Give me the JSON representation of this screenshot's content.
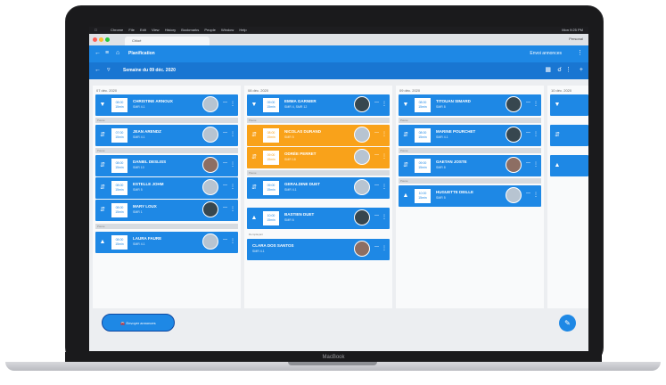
{
  "device": {
    "brand": "MacBook"
  },
  "macos_bar": {
    "app": "Chrome",
    "menu": [
      "File",
      "Edit",
      "View",
      "History",
      "Bookmarks",
      "People",
      "Window",
      "Help"
    ],
    "status": "Mon 9:25 PM"
  },
  "browser": {
    "tab_title": "Chloé",
    "profile": "Personal"
  },
  "appbar": {
    "title": "Planification",
    "right_link": "Envoi annonces"
  },
  "subbar": {
    "week_label": "Semaine du 09 déc. 2020"
  },
  "columns": [
    {
      "date": "07 déc. 2020"
    },
    {
      "date": "08 déc. 2020"
    },
    {
      "date": "09 déc. 2020"
    },
    {
      "date": "10 déc. 2020"
    }
  ],
  "cards": {
    "c1": {
      "time": "08:00",
      "duration": "15min",
      "name": "CHRISTINE ARNOUX",
      "sub": "SMR 4.1"
    },
    "c2": {
      "time": "07:00",
      "duration": "15min",
      "name": "JEAN ARENDZ",
      "sub": "SMR 4.1"
    },
    "c3": {
      "time": "08:00",
      "duration": "15min",
      "name": "DANIEL DESLISS",
      "sub": "SMR 10"
    },
    "c4": {
      "time": "08:00",
      "duration": "15min",
      "name": "ESTELLE JOHM",
      "sub": "SMR 5"
    },
    "c5": {
      "time": "08:00",
      "duration": "15min",
      "name": "MARY LOUX",
      "sub": "SMR 1"
    },
    "c6": {
      "time": "08:00",
      "duration": "15min",
      "name": "LAURA FAURE",
      "sub": "SMR 4.1"
    },
    "c7": {
      "time": "09:00",
      "duration": "15min",
      "name": "EMMA GARNIER",
      "sub": "SMR 4, SMR 12"
    },
    "c8": {
      "time": "08:00",
      "duration": "15min",
      "name": "NICOLAS DURAND",
      "sub": "SMR 5"
    },
    "c9": {
      "time": "09:00",
      "duration": "15min",
      "name": "ODRÉE PERRET",
      "sub": "SMR 18"
    },
    "c10": {
      "time": "09:00",
      "duration": "15min",
      "name": "GERALDINE DUET",
      "sub": "SMR 4.1"
    },
    "c11": {
      "time": "10:00",
      "duration": "15min",
      "name": "BASTIEN DUET",
      "sub": "SMR 6"
    },
    "c12": {
      "name": "CLARA DOS SANTOS",
      "sub": "SMR 4.1"
    },
    "c13": {
      "time": "08:00",
      "duration": "15min",
      "name": "TITOUAN SIMARD",
      "sub": "SMR 8"
    },
    "c14": {
      "time": "08:00",
      "duration": "15min",
      "name": "MARINE POURCHET",
      "sub": "SMR 4.1"
    },
    "c15": {
      "time": "09:00",
      "duration": "15min",
      "name": "GAETAN JOSTE",
      "sub": "SMR 8"
    },
    "c16": {
      "time": "10:00",
      "duration": "15min",
      "name": "HUGUETTE DEILLE",
      "sub": "SMR 5"
    }
  },
  "separators": {
    "s1": "Pause",
    "s2": "Pause",
    "s3": "Pause",
    "s4": "Pause",
    "s5": "Pause",
    "s6": "Remplaçant",
    "s7": "Pause",
    "s8": "Pause",
    "s9": "Pause"
  },
  "fab": {
    "extended_label": "Envoyer annonces",
    "edit_icon": "pencil-icon"
  },
  "colors": {
    "primary": "#1e88e5",
    "accent": "#f9a21a"
  }
}
